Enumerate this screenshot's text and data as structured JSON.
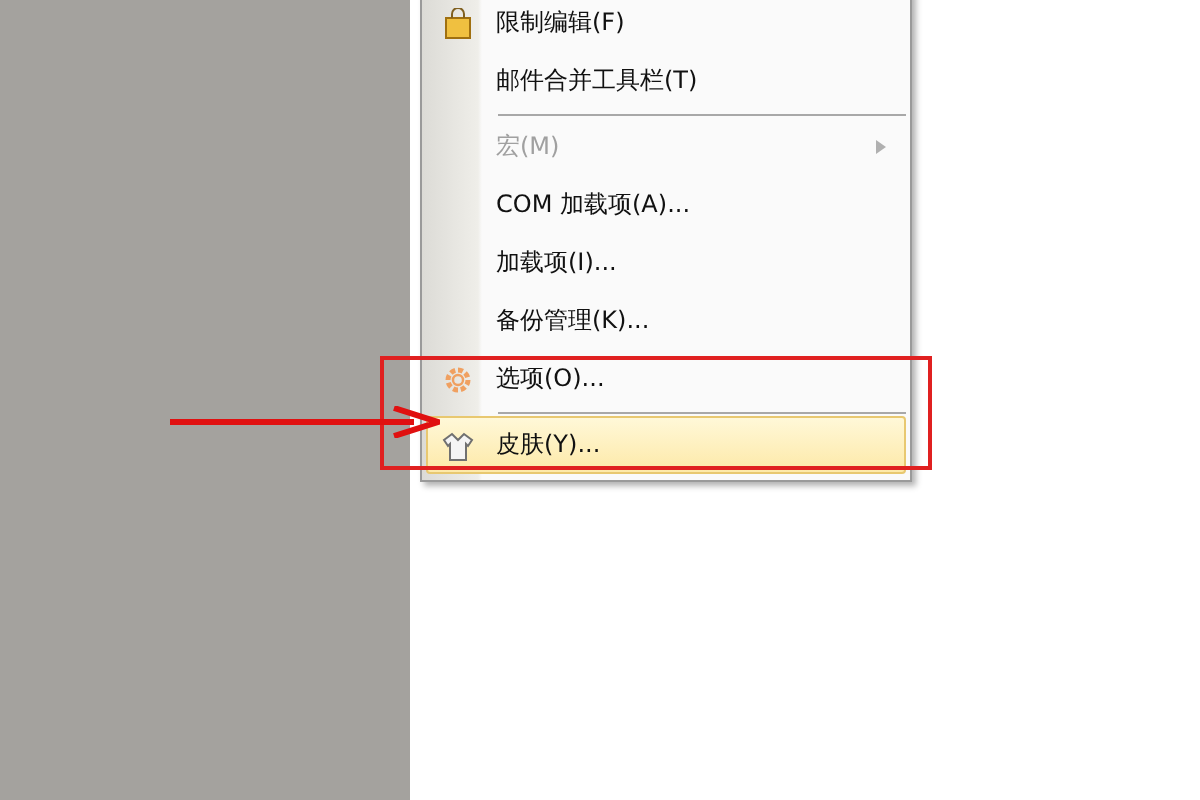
{
  "menu": {
    "items": [
      {
        "kind": "lock",
        "label": "限制编辑(F)",
        "disabled": false,
        "selected": false,
        "submenu": false
      },
      {
        "kind": "item",
        "label": "邮件合并工具栏(T)",
        "disabled": false,
        "selected": false,
        "submenu": false
      },
      {
        "kind": "separator"
      },
      {
        "kind": "item",
        "label": "宏(M)",
        "disabled": true,
        "selected": false,
        "submenu": true
      },
      {
        "kind": "item",
        "label": "COM 加载项(A)...",
        "disabled": false,
        "selected": false,
        "submenu": false
      },
      {
        "kind": "item",
        "label": "加载项(I)...",
        "disabled": false,
        "selected": false,
        "submenu": false
      },
      {
        "kind": "item",
        "label": "备份管理(K)...",
        "disabled": false,
        "selected": false,
        "submenu": false
      },
      {
        "kind": "gear",
        "label": "选项(O)...",
        "disabled": false,
        "selected": false,
        "submenu": false
      },
      {
        "kind": "separator"
      },
      {
        "kind": "shirt",
        "label": "皮肤(Y)...",
        "disabled": false,
        "selected": true,
        "submenu": false
      }
    ]
  }
}
